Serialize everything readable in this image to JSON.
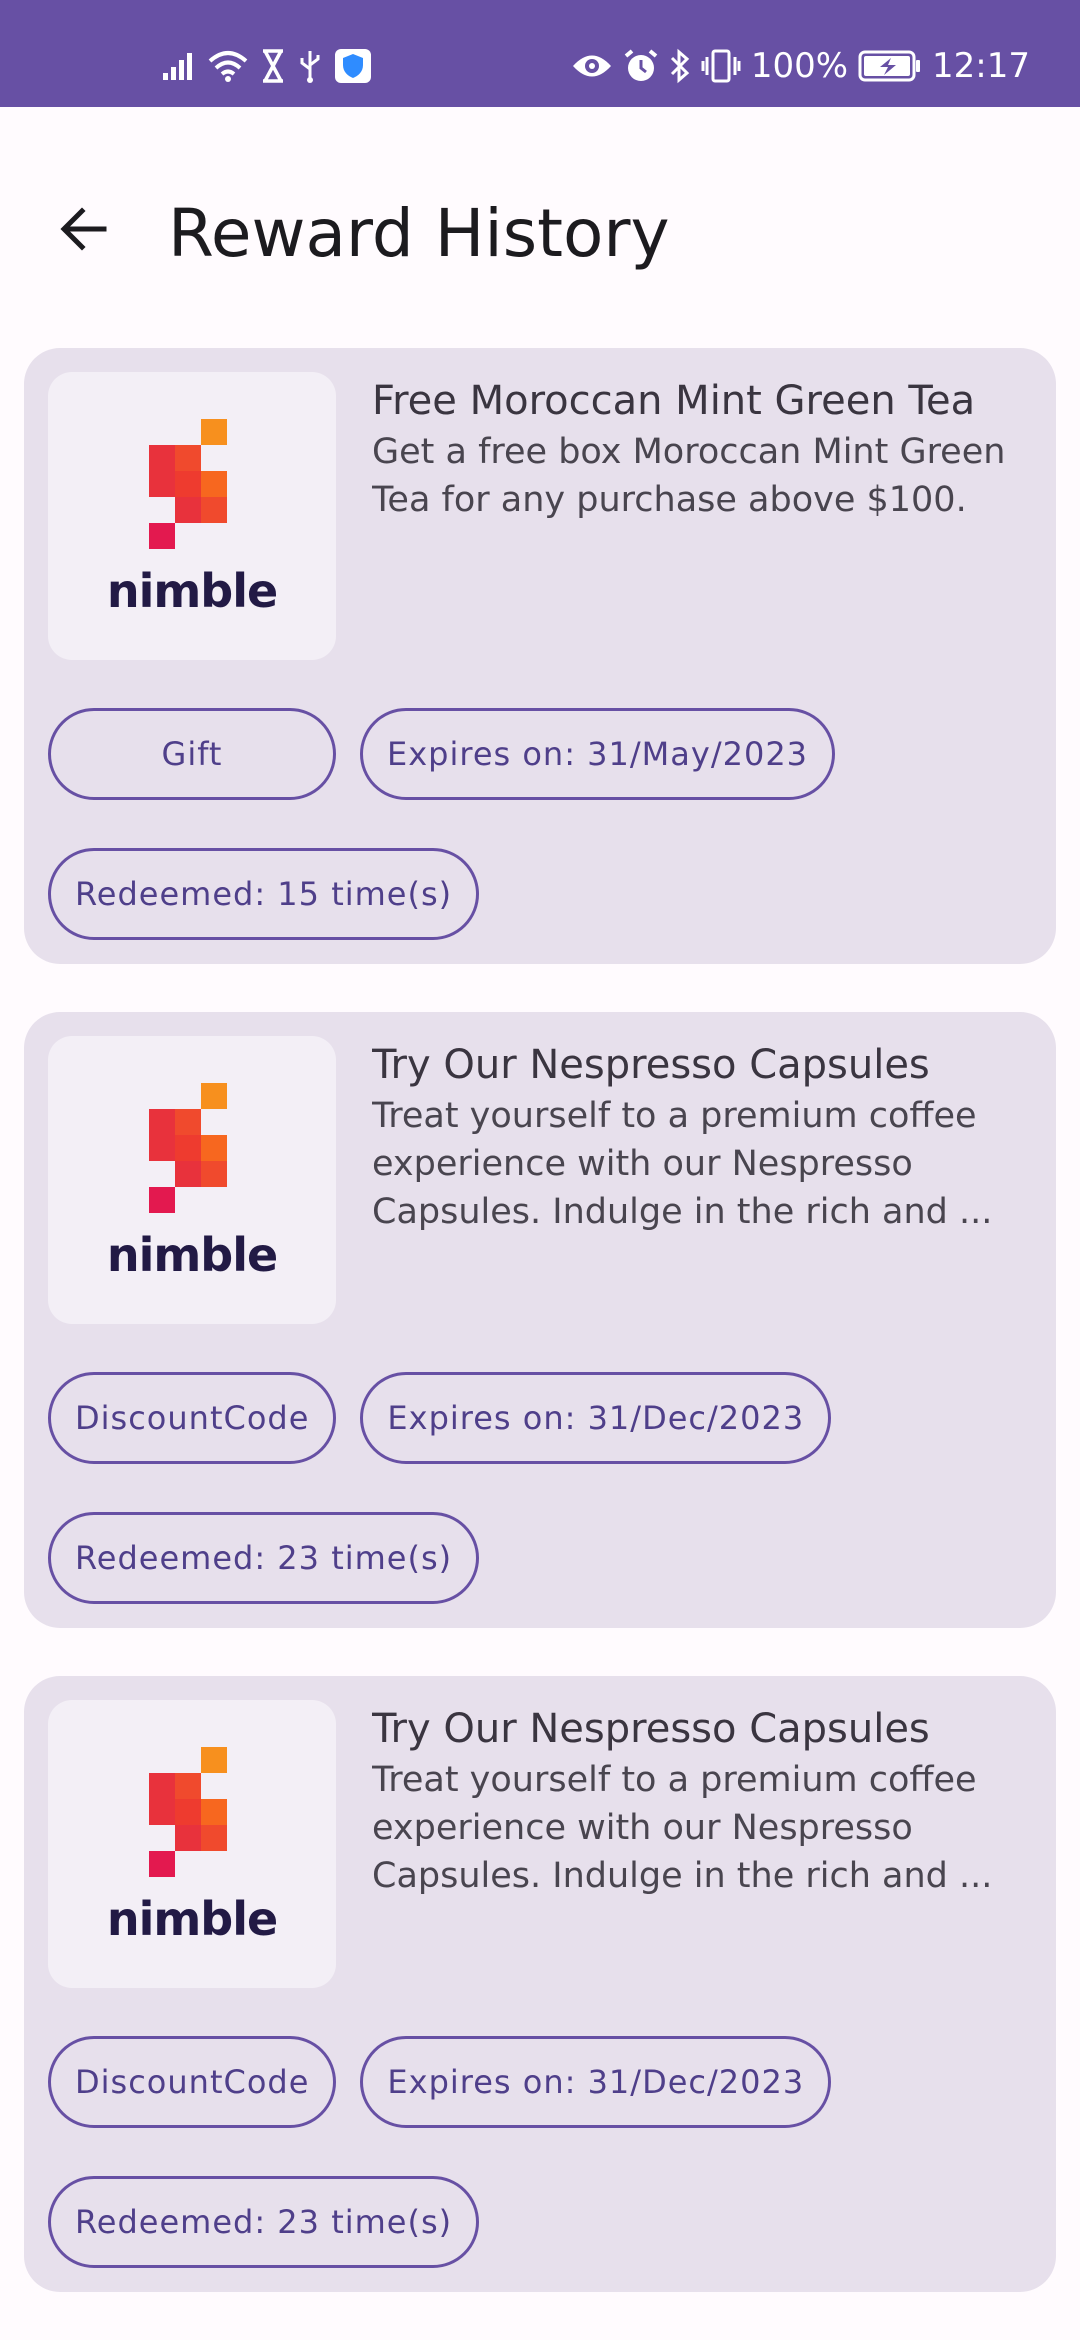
{
  "status_bar": {
    "battery_percent": "100%",
    "time": "12:17",
    "background_color": "#6750a4",
    "left_icons": [
      "signal-icon",
      "wifi-icon",
      "hourglass-icon",
      "usb-icon",
      "shield-icon"
    ],
    "right_icons": [
      "eye-icon",
      "alarm-icon",
      "bluetooth-icon",
      "vibrate-icon",
      "battery-charging-icon"
    ]
  },
  "app_bar": {
    "title": "Reward History",
    "back_icon": "arrow-back-icon"
  },
  "rewards": [
    {
      "logo_text": "nimble",
      "title": "Free Moroccan Mint Green Tea",
      "description": "Get a free box Moroccan Mint Green Tea for any purchase above $100.",
      "type": "Gift",
      "expires": "Expires on: 31/May/2023",
      "redeemed": "Redeemed: 15 time(s)"
    },
    {
      "logo_text": "nimble",
      "title": "Try Our Nespresso Capsules",
      "description": "Treat yourself to a premium coffee experience with our Nespresso Capsules. Indulge in the rich and ...",
      "type": "DiscountCode",
      "expires": "Expires on: 31/Dec/2023",
      "redeemed": "Redeemed: 23 time(s)"
    },
    {
      "logo_text": "nimble",
      "title": "Try Our Nespresso Capsules",
      "description": "Treat yourself to a premium coffee experience with our Nespresso Capsules. Indulge in the rich and ...",
      "type": "DiscountCode",
      "expires": "Expires on: 31/Dec/2023",
      "redeemed": "Redeemed: 23 time(s)"
    }
  ],
  "colors": {
    "primary": "#6750a4",
    "card_background": "#e7e0ec",
    "page_background": "#fffbfe",
    "logo_orange": "#f7901e",
    "logo_red": "#e3194f"
  }
}
